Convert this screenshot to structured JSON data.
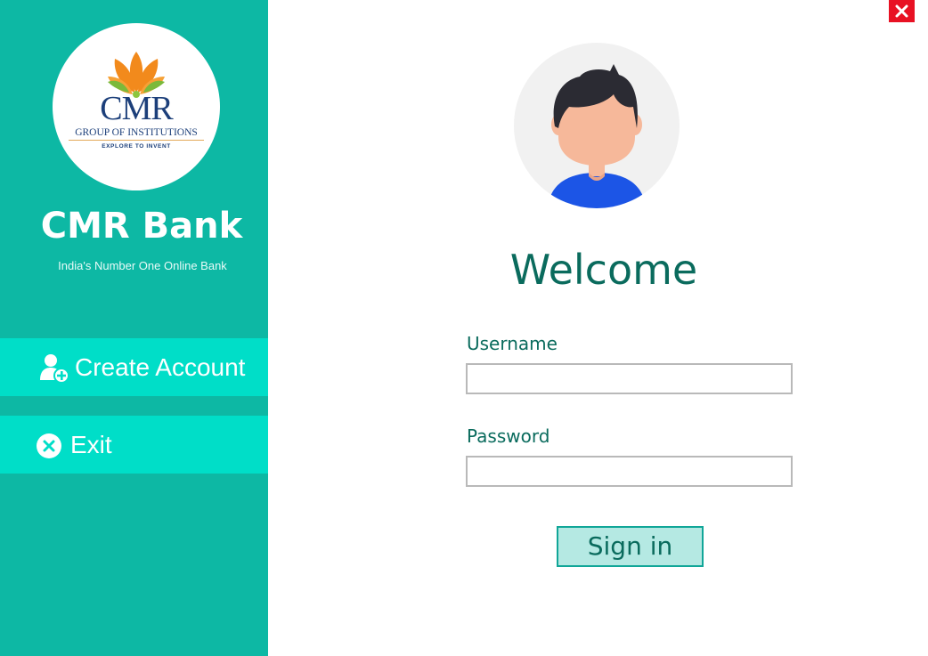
{
  "window": {
    "close_label": "×"
  },
  "sidebar": {
    "logo": {
      "main": "CMR",
      "sub": "GROUP OF INSTITUTIONS",
      "tagline": "EXPLORE TO INVENT"
    },
    "bank_name": "CMR Bank",
    "tagline": "India's Number One Online Bank",
    "items": [
      {
        "label": "Create Account",
        "icon": "add-user-icon"
      },
      {
        "label": "Exit",
        "icon": "close-circle-icon"
      }
    ]
  },
  "login": {
    "avatar_icon": "user-avatar-icon",
    "title": "Welcome",
    "username_label": "Username",
    "username_value": "",
    "password_label": "Password",
    "password_value": "",
    "signin_label": "Sign in"
  },
  "colors": {
    "sidebar": "#0db8a4",
    "sidebar_button": "#00dec8",
    "accent_text": "#0a6b5d",
    "signin_bg": "#b5e9e3",
    "close": "#e81123"
  }
}
